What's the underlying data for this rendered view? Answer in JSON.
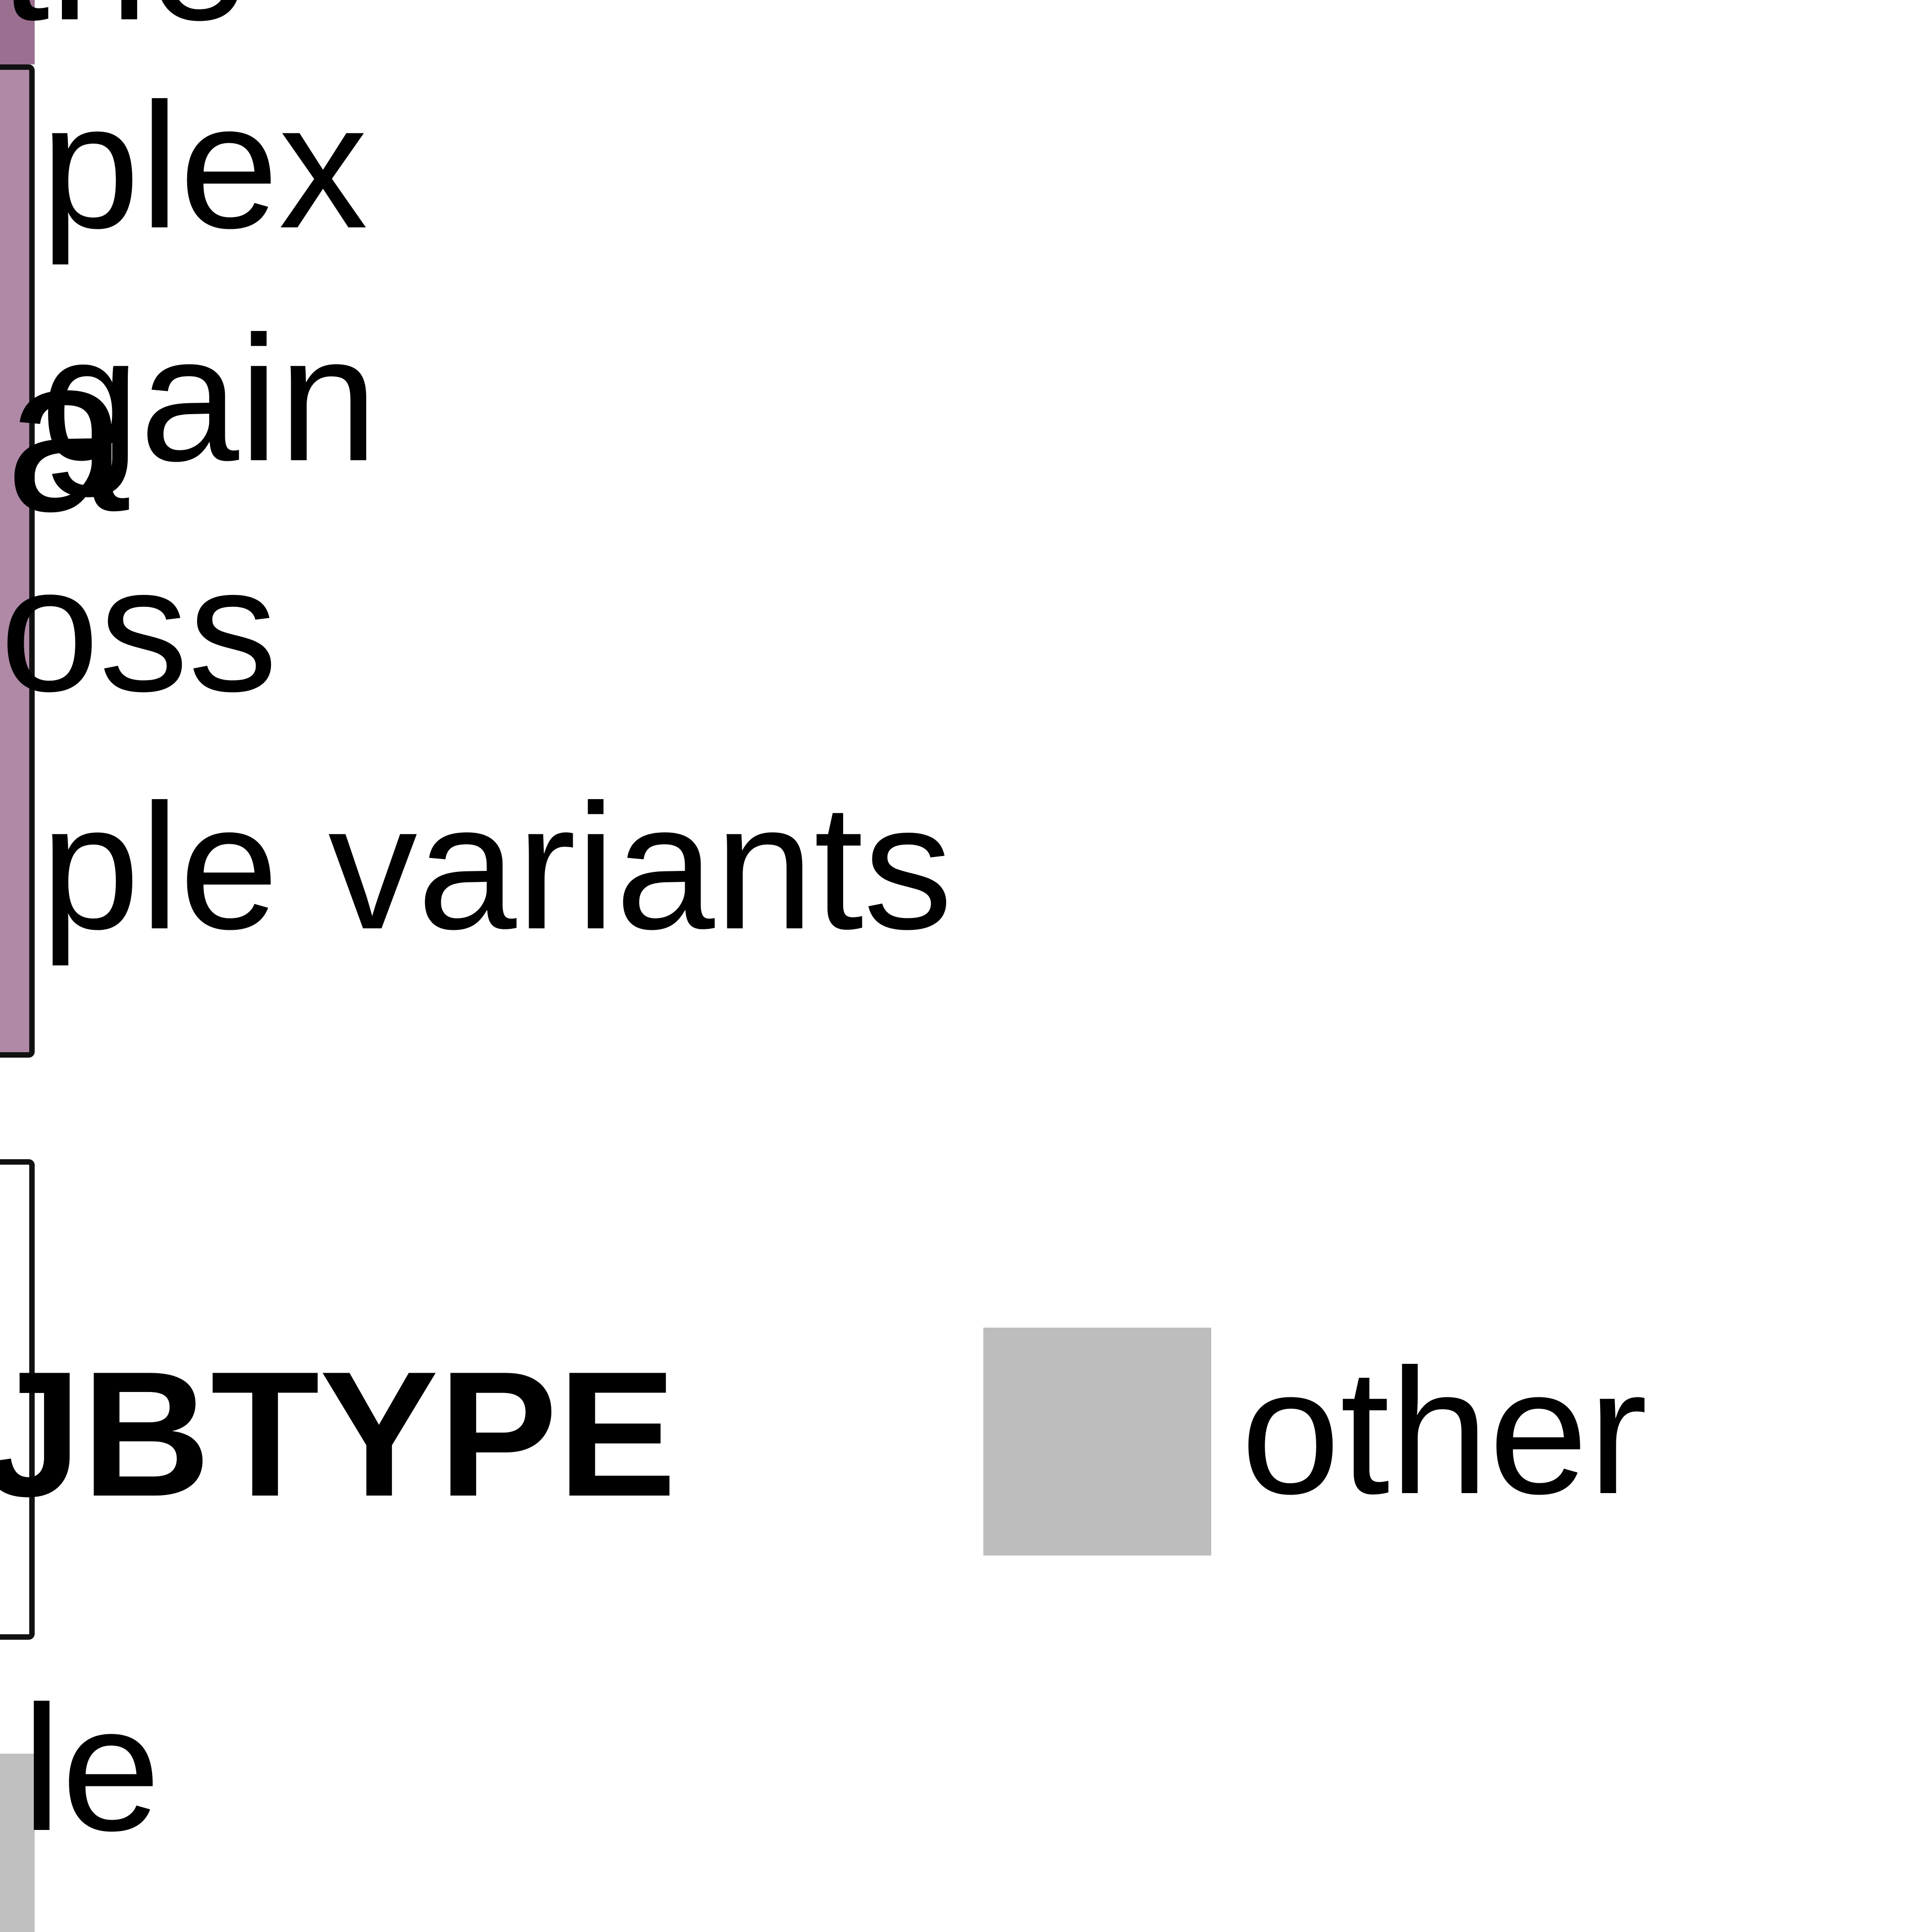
{
  "diagram": {
    "top_text": {
      "partial_word": "the",
      "line_1": "plex",
      "line_2_overlay": "a",
      "line_2": "gain",
      "line_3": "oss",
      "line_4": "ple variants"
    },
    "bottom_text": {
      "subtype_label": "JBTYPE",
      "subtype_value": "other",
      "lower_fragment": "le"
    },
    "colors": {
      "purple": "#98688C",
      "gray": "#BDBDBD",
      "stroke": "#111111"
    }
  }
}
